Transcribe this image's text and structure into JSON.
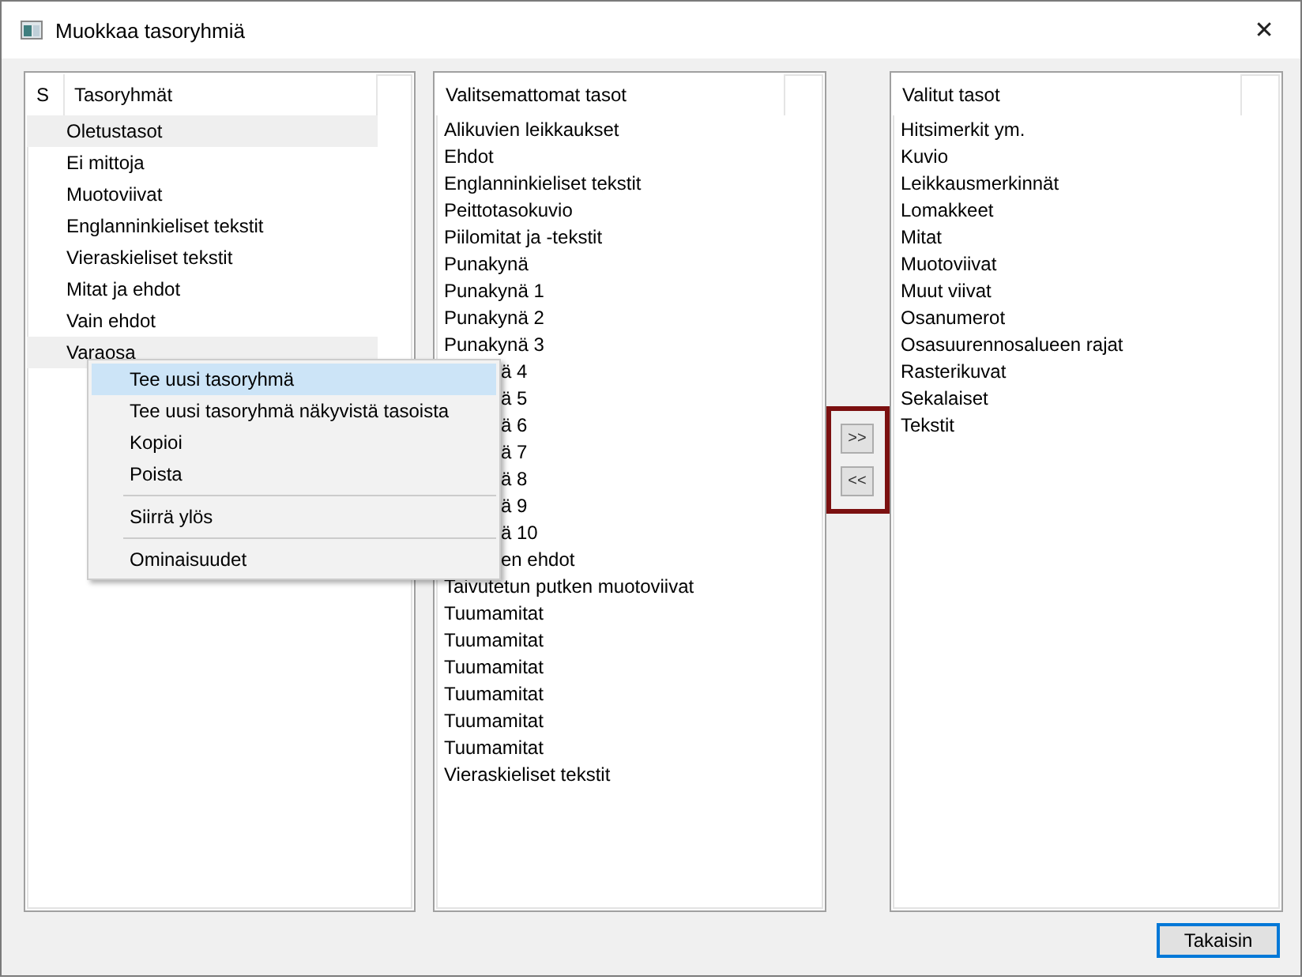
{
  "window": {
    "title": "Muokkaa tasoryhmiä",
    "close": "✕"
  },
  "groups": {
    "columns": [
      "S",
      "Tasoryhmät"
    ],
    "rows": [
      {
        "name": "Oletustasot",
        "selected": true
      },
      {
        "name": "Ei mittoja",
        "selected": false
      },
      {
        "name": "Muotoviivat",
        "selected": false
      },
      {
        "name": "Englanninkieliset tekstit",
        "selected": false
      },
      {
        "name": "Vieraskieliset tekstit",
        "selected": false
      },
      {
        "name": "Mitat ja ehdot",
        "selected": false
      },
      {
        "name": "Vain ehdot",
        "selected": false
      },
      {
        "name": "Varaosa",
        "selected": true
      }
    ]
  },
  "unselected_layers": {
    "header": "Valitsemattomat tasot",
    "items": [
      {
        "text": "Alikuvien leikkaukset",
        "kind": "full"
      },
      {
        "text": "Ehdot",
        "kind": "full"
      },
      {
        "text": "Englanninkieliset tekstit",
        "kind": "full"
      },
      {
        "text": "Peittotasokuvio",
        "kind": "full"
      },
      {
        "text": "Piilomitat ja -tekstit",
        "kind": "full"
      },
      {
        "text": "Punakynä",
        "kind": "full"
      },
      {
        "text": "Punakynä 1",
        "kind": "full"
      },
      {
        "text": "Punakynä 2",
        "kind": "full"
      },
      {
        "text": "Punakynä 3",
        "kind": "full"
      },
      {
        "text": "ä 4",
        "kind": "covered"
      },
      {
        "text": "ä 5",
        "kind": "covered"
      },
      {
        "text": "ä 6",
        "kind": "covered"
      },
      {
        "text": "ä 7",
        "kind": "covered"
      },
      {
        "text": "ä 8",
        "kind": "covered"
      },
      {
        "text": "ä 9",
        "kind": "covered"
      },
      {
        "text": "ä 10",
        "kind": "covered"
      },
      {
        "text": "en ehdot",
        "kind": "covered"
      },
      {
        "text": "Taivutetun putken muotoviivat",
        "kind": "full"
      },
      {
        "text": "Tuumamitat",
        "kind": "full"
      },
      {
        "text": "Tuumamitat",
        "kind": "full"
      },
      {
        "text": "Tuumamitat",
        "kind": "full"
      },
      {
        "text": "Tuumamitat",
        "kind": "full"
      },
      {
        "text": "Tuumamitat",
        "kind": "full"
      },
      {
        "text": "Tuumamitat",
        "kind": "full"
      },
      {
        "text": "Vieraskieliset tekstit",
        "kind": "full"
      }
    ]
  },
  "move_buttons": [
    ">>",
    "<<"
  ],
  "selected_layers": {
    "header": "Valitut tasot",
    "items": [
      "Hitsimerkit ym.",
      "Kuvio",
      "Leikkausmerkinnät",
      "Lomakkeet",
      "Mitat",
      "Muotoviivat",
      "Muut viivat",
      "Osanumerot",
      "Osasuurennosalueen rajat",
      "Rasterikuvat",
      "Sekalaiset",
      "Tekstit"
    ]
  },
  "context_menu": [
    {
      "kind": "item",
      "label": "Tee uusi tasoryhmä",
      "selected": true
    },
    {
      "kind": "item",
      "label": "Tee uusi tasoryhmä näkyvistä tasoista",
      "selected": false
    },
    {
      "kind": "item",
      "label": "Kopioi",
      "selected": false
    },
    {
      "kind": "item",
      "label": "Poista",
      "selected": false
    },
    {
      "kind": "separator"
    },
    {
      "kind": "item",
      "label": "Siirrä ylös",
      "selected": false
    },
    {
      "kind": "separator"
    },
    {
      "kind": "item",
      "label": "Ominaisuudet",
      "selected": false
    }
  ],
  "footer": {
    "button": "Takaisin"
  }
}
